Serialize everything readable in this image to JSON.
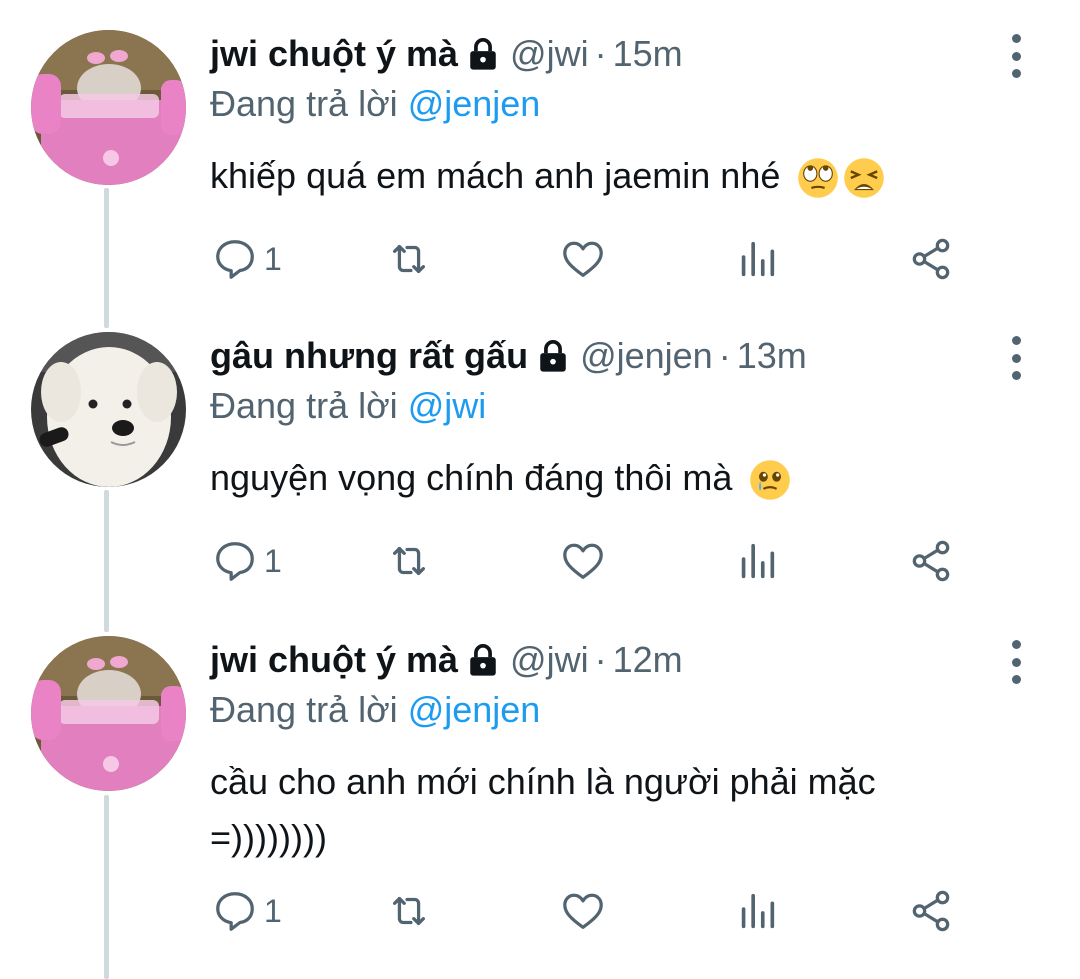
{
  "colors": {
    "text": "#0f1419",
    "secondary": "#536471",
    "mention": "#1d9bf0",
    "thread_line": "#cfd9de"
  },
  "tweets": [
    {
      "name": "jwi chuột ý mà",
      "handle": "@jwi",
      "dot": "·",
      "time": "15m",
      "reply_prefix": "Đang trả lời",
      "reply_to": "@jenjen",
      "text": "khiếp quá em mách anh jaemin nhé",
      "emojis": [
        "face-with-rolling-eyes-emoji",
        "tired-face-emoji"
      ],
      "reply_count": "1",
      "avatar": "pink-car-hamster-avatar"
    },
    {
      "name": "gâu nhưng rất gấu",
      "handle": "@jenjen",
      "dot": "·",
      "time": "13m",
      "reply_prefix": "Đang trả lời",
      "reply_to": "@jwi",
      "text": "nguyện vọng chính đáng thôi mà",
      "emojis": [
        "face-holding-back-tears-emoji"
      ],
      "reply_count": "1",
      "avatar": "white-dog-avatar"
    },
    {
      "name": "jwi chuột ý mà",
      "handle": "@jwi",
      "dot": "·",
      "time": "12m",
      "reply_prefix": "Đang trả lời",
      "reply_to": "@jenjen",
      "text_line1": "cầu cho anh mới chính là người phải mặc",
      "text_line2": "=))))))))",
      "reply_count": "1",
      "avatar": "pink-car-hamster-avatar"
    }
  ]
}
